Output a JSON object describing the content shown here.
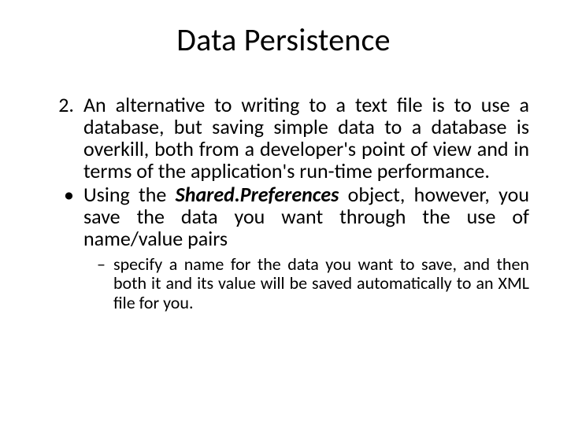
{
  "title": "Data Persistence",
  "items": {
    "numMarker": "2.",
    "numText": "An alternative to writing to a text file is to use a database, but saving simple data to a database is overkill, both from a developer's point of view and in terms of the application's run-time performance.",
    "bulMarker": "•",
    "bulPre": "Using the ",
    "bulTerm": "Shared.Preferences",
    "bulPost": " object, however, you save the data you want through the use of name/value pairs",
    "subMarker": "–",
    "subText": " specify a name for the data you want to save, and then both it and its value will be saved automatically to an XML file for you."
  }
}
